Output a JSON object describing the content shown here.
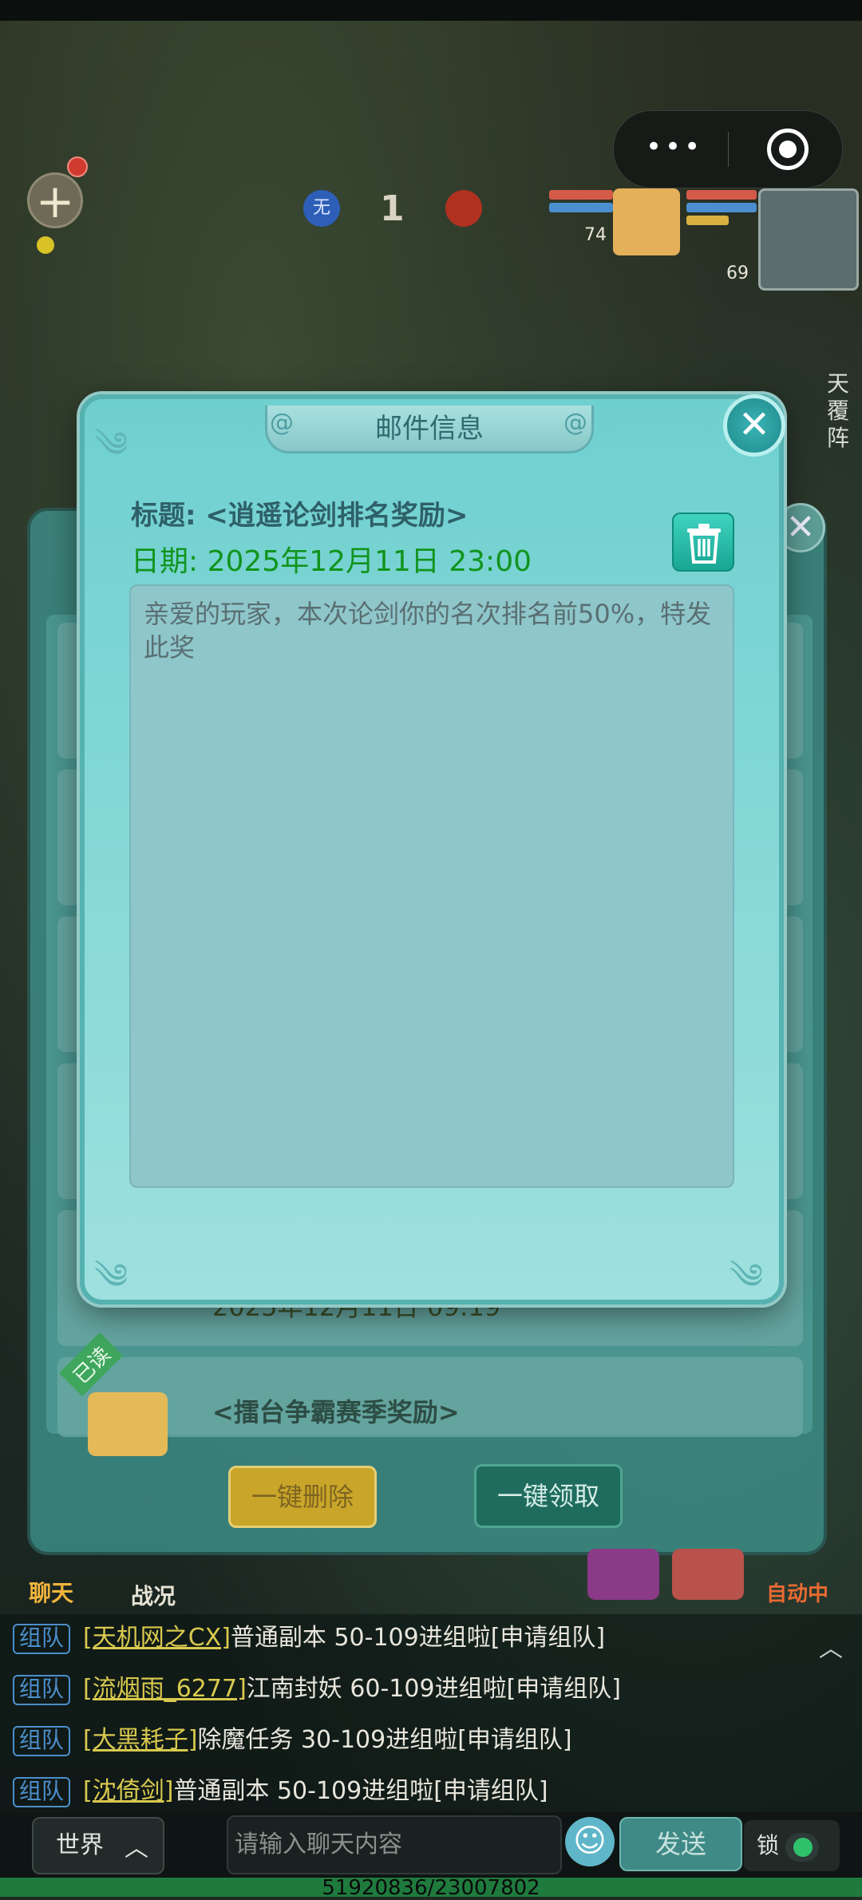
{
  "hud": {
    "add_symbol": "+",
    "orb_label": "无",
    "ring_count": "1",
    "party_levels": [
      "74",
      "69"
    ],
    "side_text": "天覆阵"
  },
  "mail_list": {
    "row5_date": "2025年12月11日 09:19",
    "row6_tag": "已读",
    "row6_title": "<擂台争霸赛季奖励>",
    "delete_all_label": "一键删除",
    "claim_all_label": "一键领取"
  },
  "popup": {
    "title": "邮件信息",
    "subject": "标题: <逍遥论剑排名奖励>",
    "date": "日期: 2025年12月11日 23:00",
    "body": "亲爱的玩家，本次论剑你的名次排名前50%，特发此奖"
  },
  "bottom_hud": {
    "chat_label": "聊天",
    "battle_label": "战况",
    "auto_label": "自动中"
  },
  "chat": {
    "lines": [
      {
        "tag": "组队",
        "name": "[天机网之CX]",
        "msg": "普通副本 50-109进组啦[申请组队]"
      },
      {
        "tag": "组队",
        "name": "[流烟雨_6277]",
        "msg": "江南封妖 60-109进组啦[申请组队]"
      },
      {
        "tag": "组队",
        "name": "[大黑耗子]",
        "msg": "除魔任务 30-109进组啦[申请组队]"
      },
      {
        "tag": "组队",
        "name": "[沈倚剑]",
        "msg": "普通副本 50-109进组啦[申请组队]"
      }
    ],
    "channel_label": "世界",
    "input_placeholder": "请输入聊天内容",
    "send_label": "发送",
    "lock_label": "锁"
  },
  "footer_id": "51920836/23007802",
  "colors": {
    "popup_bg": "#8adad8",
    "date_green": "#11941d",
    "chat_name": "#d9c94f",
    "chat_tag": "#4c8fcb"
  }
}
